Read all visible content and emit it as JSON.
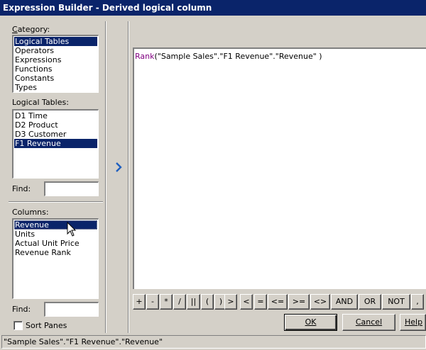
{
  "window": {
    "title": "Expression Builder - Derived logical column"
  },
  "category": {
    "label": "Category:",
    "items": [
      "Logical Tables",
      "Operators",
      "Expressions",
      "Functions",
      "Constants",
      "Types"
    ],
    "selected": "Logical Tables"
  },
  "logical_tables": {
    "label": "Logical Tables:",
    "items": [
      "D1 Time",
      "D2 Product",
      "D3 Customer",
      "F1 Revenue"
    ],
    "selected": "F1 Revenue"
  },
  "find_tables": {
    "label": "Find:",
    "value": ""
  },
  "columns": {
    "label": "Columns:",
    "items": [
      "Revenue",
      "Units",
      "Actual Unit Price",
      "Revenue Rank"
    ],
    "selected": "Revenue"
  },
  "find_columns": {
    "label": "Find:",
    "value": ""
  },
  "sort_panes": {
    "label": "Sort Panes",
    "checked": false
  },
  "insert_arrow": {
    "icon": "chevron-right-icon"
  },
  "expression": {
    "function": "Rank",
    "args": "(\"Sample Sales\".\"F1 Revenue\".\"Revenue\" )"
  },
  "operators": [
    "+",
    "-",
    "*",
    "/",
    "||",
    "(",
    ")",
    ">",
    "<",
    "=",
    "<=",
    ">=",
    "<>",
    "AND",
    "OR",
    "NOT",
    ","
  ],
  "buttons": {
    "ok": "OK",
    "cancel": "Cancel",
    "help": "Help"
  },
  "status": {
    "text": "\"Sample Sales\".\"F1 Revenue\".\"Revenue\""
  },
  "colors": {
    "selection": "#0a246a",
    "function_name": "#800080",
    "chevron": "#1f5fbf"
  }
}
